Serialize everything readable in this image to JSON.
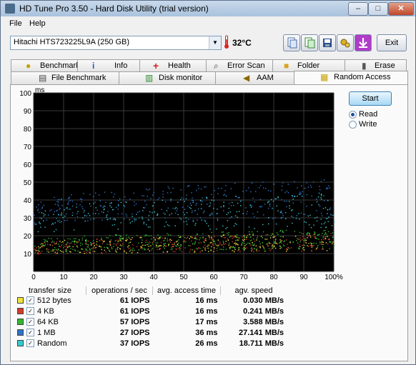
{
  "window": {
    "title": "HD Tune Pro 3.50 - Hard Disk Utility (trial version)"
  },
  "menu": {
    "file": "File",
    "help": "Help"
  },
  "toolbar": {
    "drive": "Hitachi HTS723225L9A (250 GB)",
    "temperature": "32°C",
    "exit_label": "Exit",
    "icons": [
      "copy-info-icon",
      "copy-screen-icon",
      "save-icon",
      "options-icon",
      "download-icon"
    ]
  },
  "tabs": {
    "row1": [
      "Benchmark",
      "Info",
      "Health",
      "Error Scan",
      "Folder Usage",
      "Erase"
    ],
    "row2": [
      "File Benchmark",
      "Disk monitor",
      "AAM",
      "Random Access"
    ],
    "active": "Random Access"
  },
  "controls": {
    "start_label": "Start",
    "read_label": "Read",
    "write_label": "Write",
    "selected": "Read"
  },
  "results": {
    "headers": [
      "transfer size",
      "operations / sec",
      "avg. access time",
      "agv. speed"
    ],
    "rows": [
      {
        "size": "512 bytes",
        "ops": "61 IOPS",
        "access": "16 ms",
        "speed": "0.030 MB/s",
        "color": "#f2e33c",
        "checked": true
      },
      {
        "size": "4 KB",
        "ops": "61 IOPS",
        "access": "16 ms",
        "speed": "0.241 MB/s",
        "color": "#d23b2a",
        "checked": true
      },
      {
        "size": "64 KB",
        "ops": "57 IOPS",
        "access": "17 ms",
        "speed": "3.588 MB/s",
        "color": "#33b633",
        "checked": true
      },
      {
        "size": "1 MB",
        "ops": "27 IOPS",
        "access": "36 ms",
        "speed": "27.141 MB/s",
        "color": "#2f74c8",
        "checked": true
      },
      {
        "size": "Random",
        "ops": "37 IOPS",
        "access": "26 ms",
        "speed": "18.711 MB/s",
        "color": "#39c7cf",
        "checked": true
      }
    ]
  },
  "chart_data": {
    "type": "scatter",
    "ylabel": "ms",
    "ylim": [
      0,
      100
    ],
    "xlim": [
      0,
      100
    ],
    "y_ticks": [
      "10",
      "20",
      "30",
      "40",
      "50",
      "60",
      "70",
      "80",
      "90",
      "100"
    ],
    "x_ticks": [
      "0",
      "10",
      "20",
      "30",
      "40",
      "50",
      "60",
      "70",
      "80",
      "90",
      "100%"
    ],
    "grid": true,
    "background": "#000000",
    "series": [
      {
        "name": "512 bytes",
        "color": "#f2e33c",
        "band": [
          6,
          22
        ]
      },
      {
        "name": "4 KB",
        "color": "#d23b2a",
        "band": [
          6,
          22
        ]
      },
      {
        "name": "64 KB",
        "color": "#33b633",
        "band": [
          7,
          24
        ]
      },
      {
        "name": "1 MB",
        "color": "#2f74c8",
        "band": [
          18,
          52
        ]
      },
      {
        "name": "Random",
        "color": "#39c7cf",
        "band": [
          14,
          45
        ]
      }
    ]
  }
}
